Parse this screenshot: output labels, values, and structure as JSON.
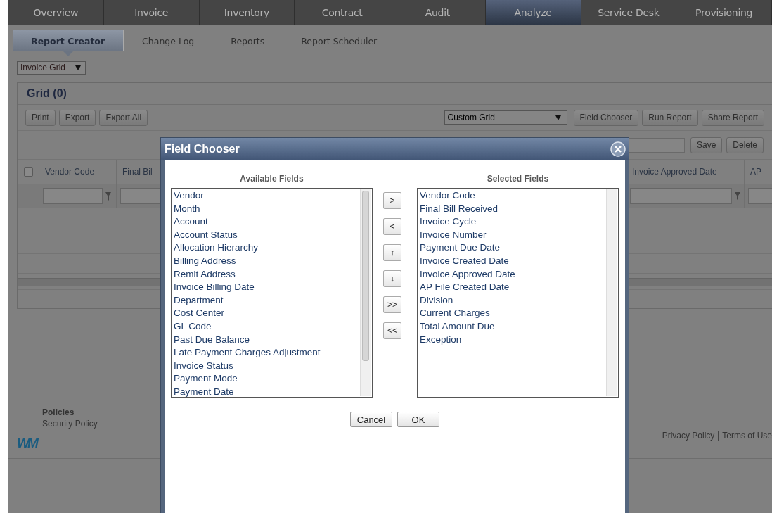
{
  "nav": {
    "tabs": [
      {
        "label": "Overview",
        "selected": false
      },
      {
        "label": "Invoice",
        "selected": false
      },
      {
        "label": "Inventory",
        "selected": false
      },
      {
        "label": "Contract",
        "selected": false
      },
      {
        "label": "Audit",
        "selected": false
      },
      {
        "label": "Analyze",
        "selected": true
      },
      {
        "label": "Service Desk",
        "selected": false
      },
      {
        "label": "Provisioning",
        "selected": false
      }
    ]
  },
  "subnav": {
    "tabs": [
      {
        "label": "Report Creator",
        "selected": true
      },
      {
        "label": "Change Log",
        "selected": false
      },
      {
        "label": "Reports",
        "selected": false
      },
      {
        "label": "Report Scheduler",
        "selected": false
      }
    ]
  },
  "grid_selector": {
    "value": "Invoice Grid"
  },
  "grid": {
    "title": "Grid (0)",
    "left_buttons": [
      "Print",
      "Export",
      "Export All"
    ],
    "view_select": {
      "value": "Custom Grid"
    },
    "right_buttons": [
      "Field Chooser",
      "Run Report",
      "Share Report"
    ],
    "save_buttons": [
      "Save",
      "Delete"
    ],
    "header_checkbox": {
      "checked": false
    },
    "columns": [
      "Vendor Code",
      "Final Bil",
      "Invoice Approved Date",
      "AP"
    ]
  },
  "footer": {
    "heading": "Policies",
    "links": [
      "Security Policy"
    ],
    "logo": "WM",
    "legal_links": [
      "Privacy Policy",
      "Terms of Use"
    ]
  },
  "dialog": {
    "title": "Field Chooser",
    "available": {
      "label": "Available Fields",
      "items": [
        "Vendor",
        "Month",
        "Account",
        "Account Status",
        "Allocation Hierarchy",
        "Billing Address",
        "Remit Address",
        "Invoice Billing Date",
        "Department",
        "Cost Center",
        "GL Code",
        "Past Due Balance",
        "Late Payment Charges Adjustment",
        "Invoice Status",
        "Payment Mode",
        "Payment Date"
      ]
    },
    "move_buttons": [
      ">",
      "<",
      "↑",
      "↓",
      ">>",
      "<<"
    ],
    "selected": {
      "label": "Selected Fields",
      "items": [
        "Vendor Code",
        "Final Bill Received",
        "Invoice Cycle",
        "Invoice Number",
        "Payment Due Date",
        "Invoice Created Date",
        "Invoice Approved Date",
        "AP File Created Date",
        "Division",
        "Current Charges",
        "Total Amount Due",
        "Exception"
      ]
    },
    "buttons": [
      "Cancel",
      "OK"
    ]
  }
}
